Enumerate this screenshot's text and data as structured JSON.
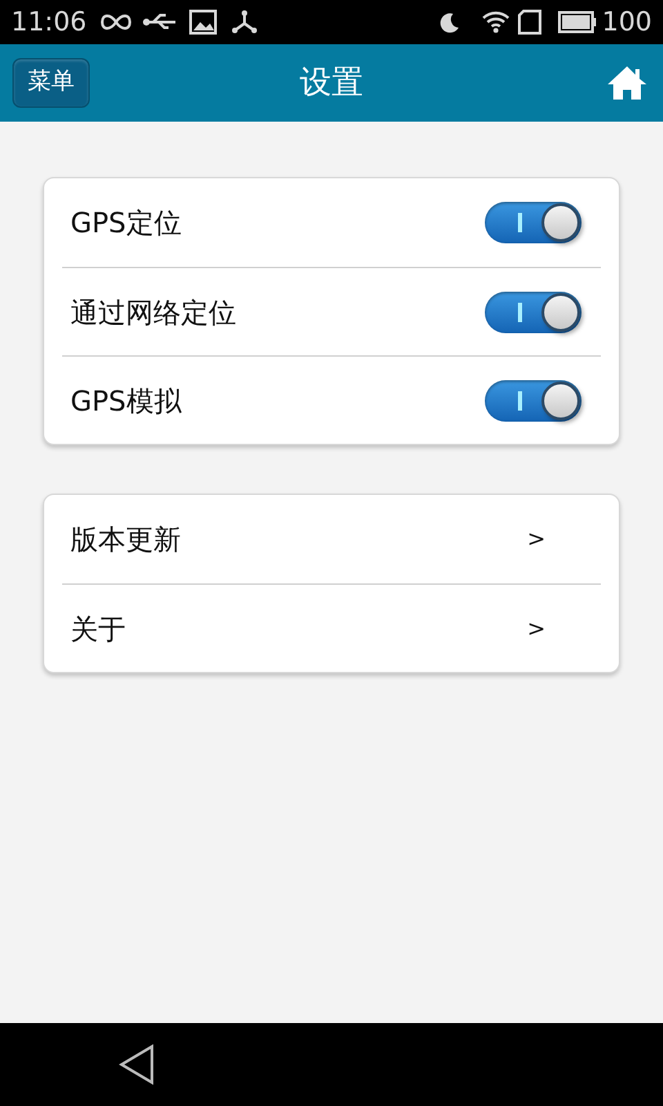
{
  "status_bar": {
    "time": "11:06",
    "battery_text": "100"
  },
  "header": {
    "menu_button": "菜单",
    "title": "设置"
  },
  "toggle_group": [
    {
      "label": "GPS定位",
      "on": true
    },
    {
      "label": "通过网络定位",
      "on": true
    },
    {
      "label": "GPS模拟",
      "on": true
    }
  ],
  "link_group": [
    {
      "label": "版本更新",
      "chevron": ">"
    },
    {
      "label": "关于",
      "chevron": ">"
    }
  ]
}
